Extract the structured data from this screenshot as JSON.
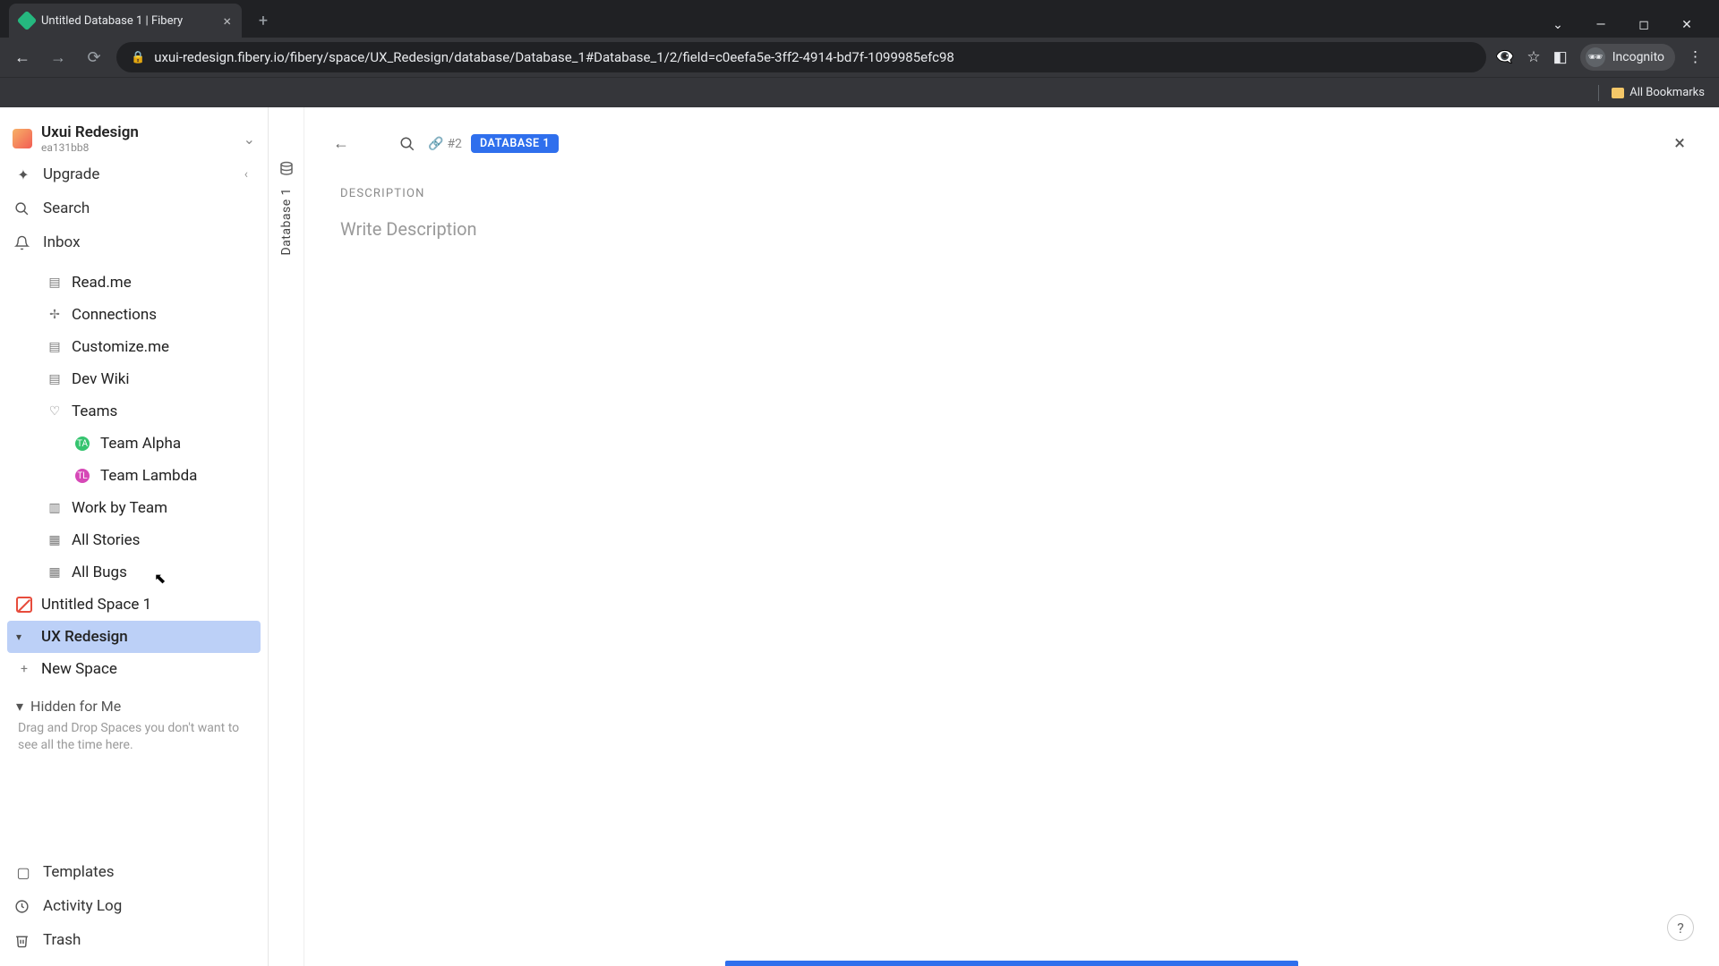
{
  "browser": {
    "tab_title": "Untitled Database 1 | Fibery",
    "url": "uxui-redesign.fibery.io/fibery/space/UX_Redesign/database/Database_1#Database_1/2/field=c0eefa5e-3ff2-4914-bd7f-1099985efc98",
    "incognito_label": "Incognito",
    "all_bookmarks": "All Bookmarks"
  },
  "workspace": {
    "name": "Uxui Redesign",
    "id": "ea131bb8"
  },
  "sidebar": {
    "upgrade": "Upgrade",
    "search": "Search",
    "inbox": "Inbox",
    "tree": {
      "readme": "Read.me",
      "connections": "Connections",
      "customize": "Customize.me",
      "devwiki": "Dev Wiki",
      "teams": "Teams",
      "team_alpha": "Team Alpha",
      "team_alpha_initials": "TA",
      "team_lambda": "Team Lambda",
      "team_lambda_initials": "TL",
      "work_by_team": "Work by Team",
      "all_stories": "All Stories",
      "all_bugs": "All Bugs",
      "untitled_space": "Untitled Space 1",
      "ux_redesign": "UX Redesign",
      "new_space": "New Space"
    },
    "hidden": {
      "header": "Hidden for Me",
      "hint": "Drag and Drop Spaces you don't want to see all the time here."
    },
    "bottom": {
      "templates": "Templates",
      "activity_log": "Activity Log",
      "trash": "Trash"
    }
  },
  "rail": {
    "label": "Database 1"
  },
  "main": {
    "ref_count": "#2",
    "db_badge": "DATABASE 1",
    "description_label": "DESCRIPTION",
    "description_placeholder": "Write Description",
    "help": "?"
  }
}
